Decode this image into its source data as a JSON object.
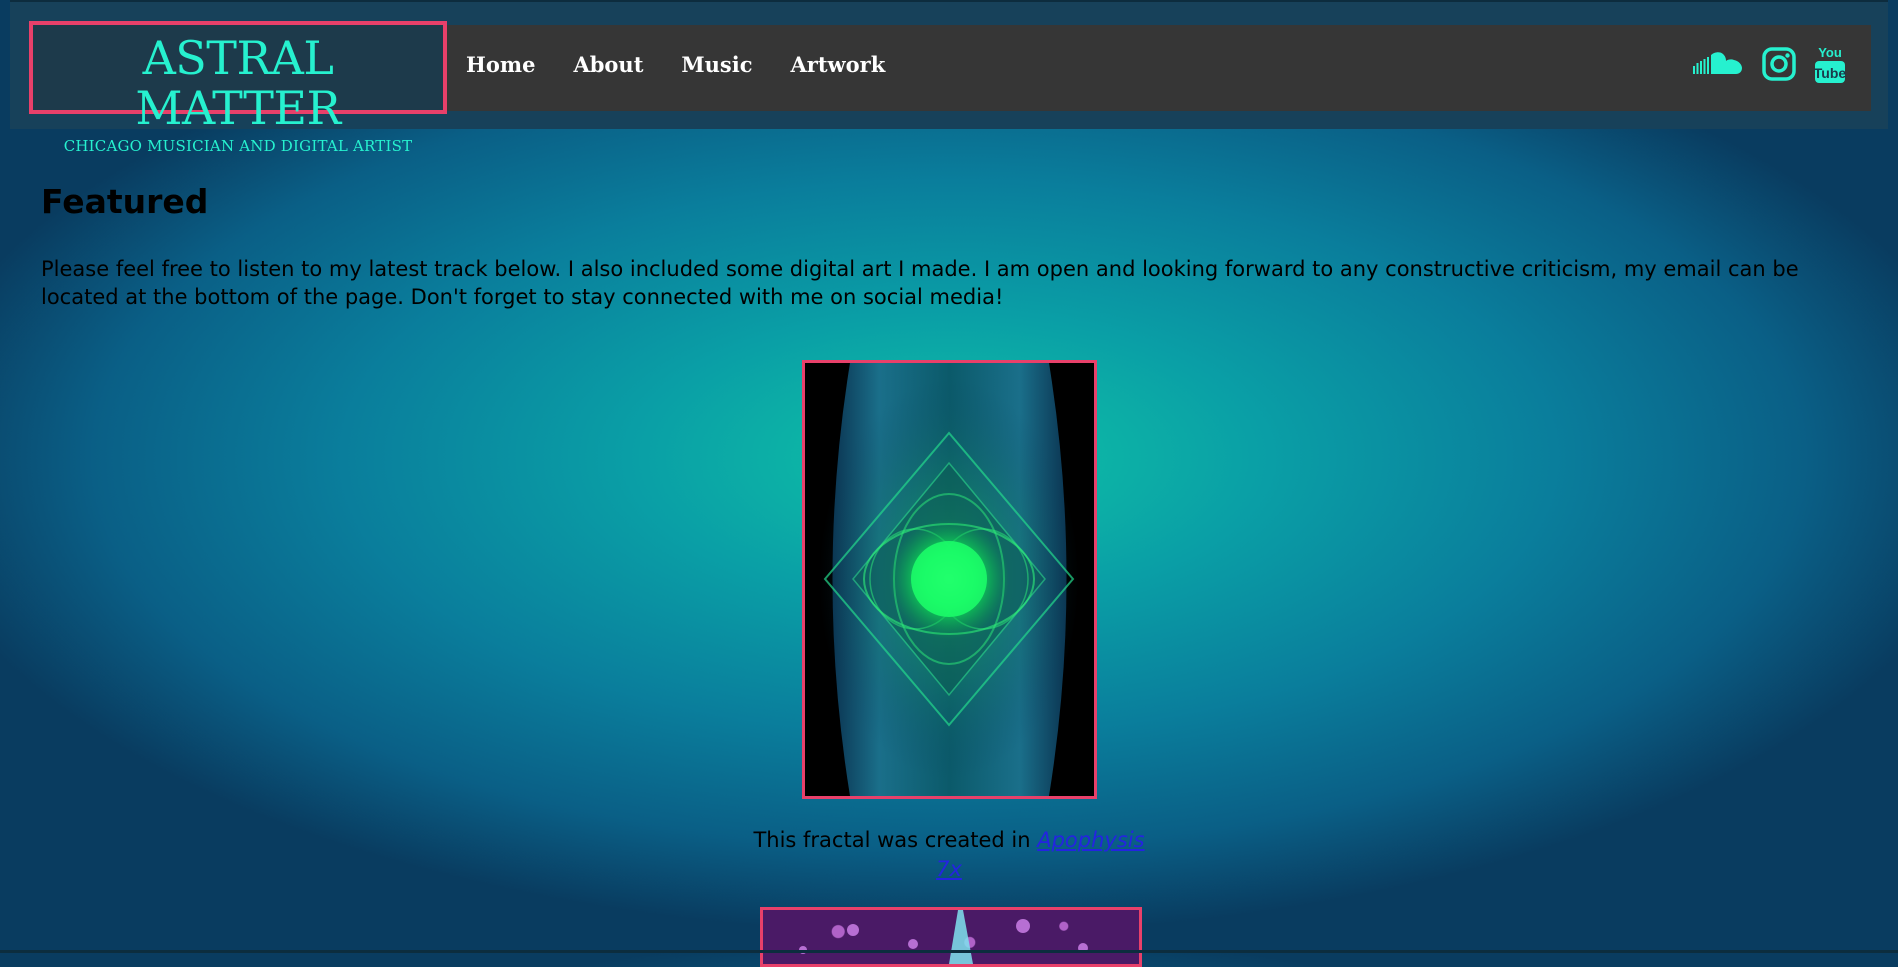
{
  "brand": {
    "title": "ASTRAL MATTER",
    "subtitle": "CHICAGO MUSICIAN AND DIGITAL ARTIST"
  },
  "nav": {
    "items": [
      {
        "label": "Home"
      },
      {
        "label": "About"
      },
      {
        "label": "Music"
      },
      {
        "label": "Artwork"
      }
    ]
  },
  "social": {
    "icons": [
      "soundcloud-icon",
      "instagram-icon",
      "youtube-icon"
    ]
  },
  "featured": {
    "heading": "Featured",
    "intro": "Please feel free to listen to my latest track below. I also included some digital art I made. I am open and looking forward to any constructive criticism, my email can be located at the bottom of the page. Don't forget to stay connected with me on social media!",
    "caption_prefix": "This fractal was created in ",
    "caption_link": "Apophysis 7x"
  },
  "colors": {
    "accent": "#26f1cf",
    "frame": "#e8406a",
    "nav_bg": "#363636",
    "link": "#2424e0"
  }
}
